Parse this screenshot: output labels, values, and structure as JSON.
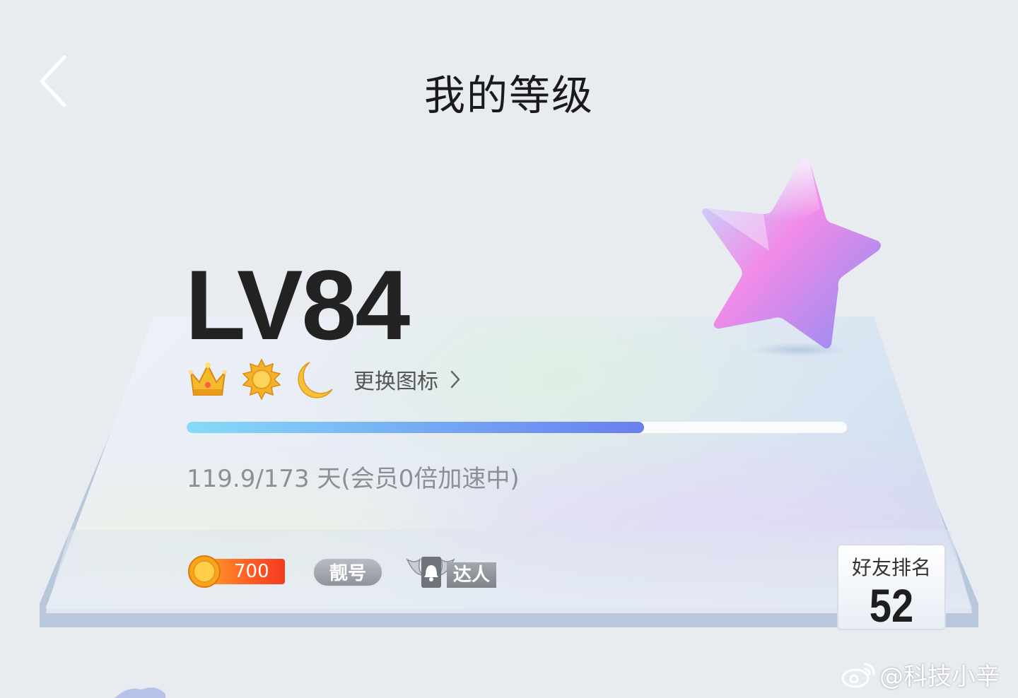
{
  "header": {
    "title": "我的等级"
  },
  "level": {
    "label": "LV84"
  },
  "badges": {
    "icons": [
      "crown-icon",
      "sun-icon",
      "moon-icon"
    ],
    "change_label": "更换图标"
  },
  "progress": {
    "current": 119.9,
    "total": 173,
    "fraction": 0.693,
    "text": "119.9/173 天(会员0倍加速中)"
  },
  "privileges": {
    "coin_value": "700",
    "handsome_label": "靓号",
    "master_label": "达人"
  },
  "rank": {
    "label": "好友排名",
    "value": "52"
  },
  "watermark": {
    "text": "@科技小辛"
  },
  "colors": {
    "accent_start": "#86dbf7",
    "accent_end": "#6a7ef0",
    "coin": "#ff5a24"
  }
}
